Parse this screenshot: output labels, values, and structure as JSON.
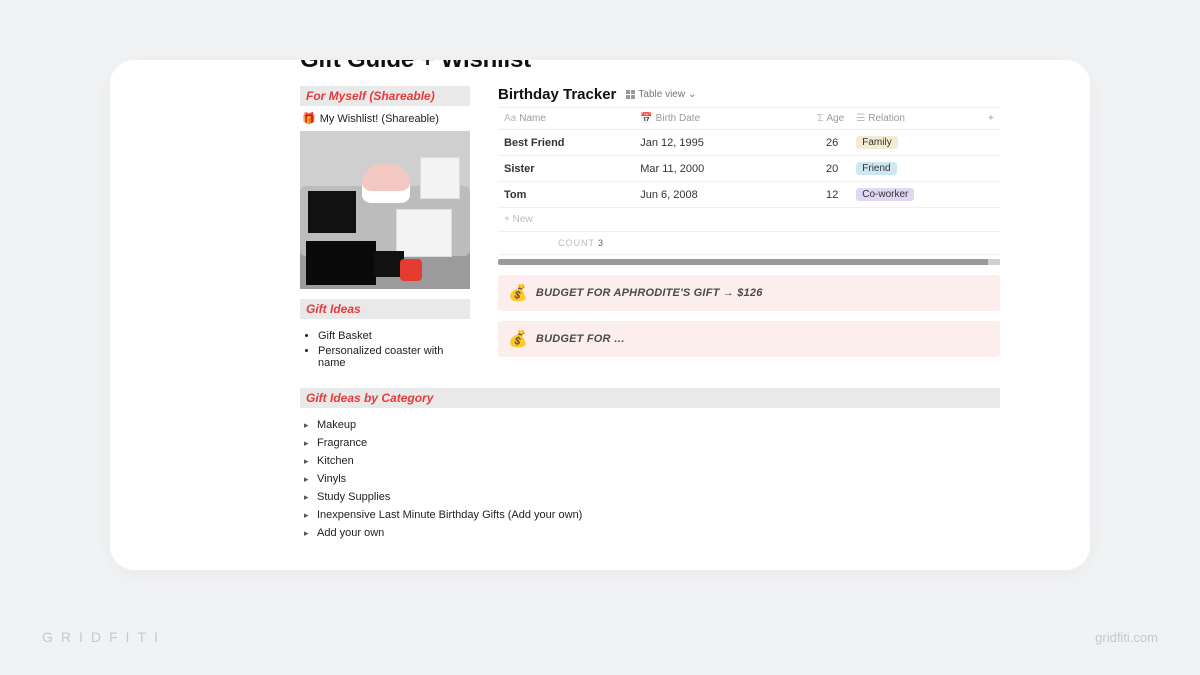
{
  "page": {
    "title": "Gift Guide + Wishlist"
  },
  "sections": {
    "for_myself": {
      "heading": "For Myself (Shareable)",
      "link_icon": "🎁",
      "link_label": "My Wishlist! (Shareable)"
    },
    "gift_ideas": {
      "heading": "Gift Ideas",
      "items": [
        "Gift Basket",
        "Personalized coaster with name"
      ]
    },
    "by_category": {
      "heading": "Gift Ideas by Category",
      "items": [
        "Makeup",
        "Fragrance",
        "Kitchen",
        "Vinyls",
        "Study Supplies",
        "Inexpensive Last Minute Birthday Gifts  (Add your own)",
        "Add your own"
      ]
    }
  },
  "tracker": {
    "title": "Birthday Tracker",
    "view_label": "Table view",
    "columns": {
      "name": "Name",
      "birth_date": "Birth Date",
      "age": "Age",
      "relation": "Relation"
    },
    "rows": [
      {
        "name": "Best Friend",
        "birth_date": "Jan 12, 1995",
        "age": "26",
        "relation": "Family",
        "relation_color": "#f3ecd2"
      },
      {
        "name": "Sister",
        "birth_date": "Mar 11, 2000",
        "age": "20",
        "relation": "Friend",
        "relation_color": "#cfe7f2"
      },
      {
        "name": "Tom",
        "birth_date": "Jun 6, 2008",
        "age": "12",
        "relation": "Co-worker",
        "relation_color": "#e0d7f2"
      }
    ],
    "new_label": "+  New",
    "count_label": "COUNT",
    "count_value": "3"
  },
  "callouts": [
    {
      "icon": "💰",
      "text": "BUDGET FOR APHRODITE'S GIFT → $126"
    },
    {
      "icon": "💰",
      "text": "BUDGET FOR …"
    }
  ],
  "watermark": {
    "left": "GRIDFITI",
    "right": "gridfiti.com"
  }
}
